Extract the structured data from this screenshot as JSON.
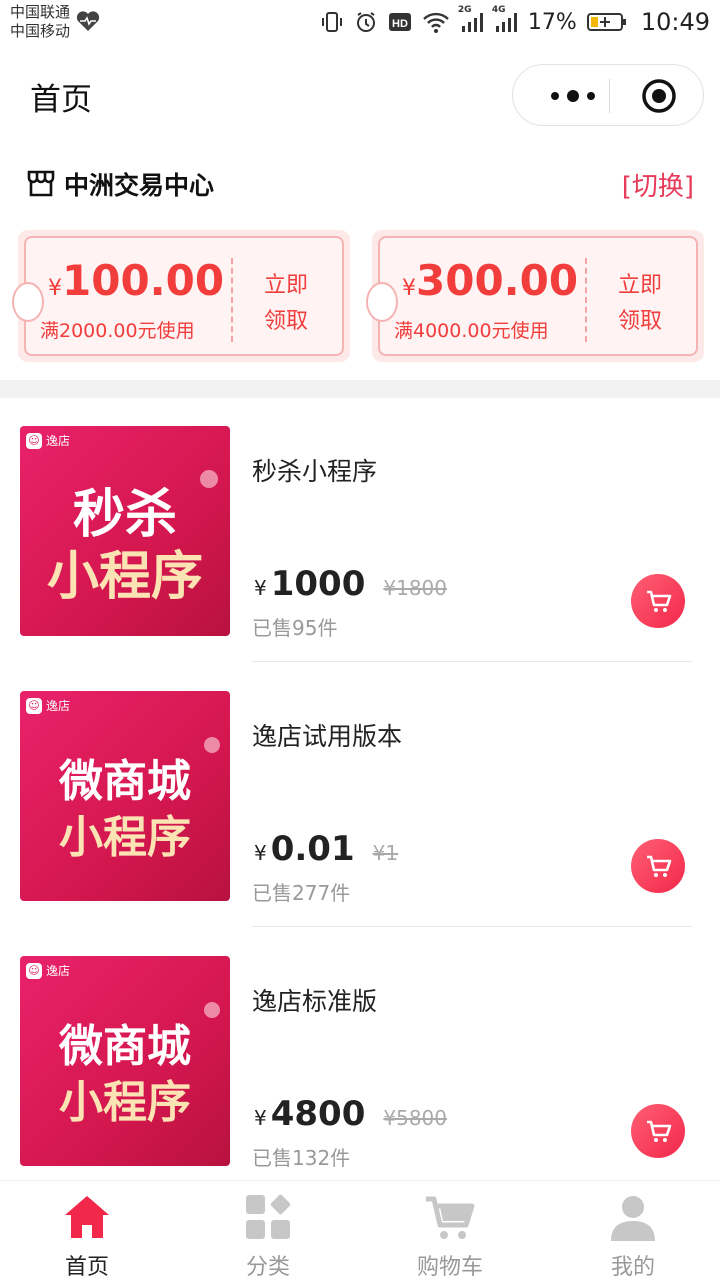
{
  "status_bar": {
    "carrier1": "中国联通",
    "carrier2": "中国移动",
    "net1": "2G",
    "net2": "4G",
    "battery": "17%",
    "time": "10:49"
  },
  "header": {
    "title": "首页"
  },
  "store": {
    "name": "中洲交易中心",
    "switch_label": "[切换]"
  },
  "coupons": [
    {
      "currency": "¥",
      "amount": "100.00",
      "condition": "满2000.00元使用",
      "claim1": "立即",
      "claim2": "领取"
    },
    {
      "currency": "¥",
      "amount": "300.00",
      "condition": "满4000.00元使用",
      "claim1": "立即",
      "claim2": "领取"
    }
  ],
  "products": [
    {
      "name": "秒杀小程序",
      "currency": "¥",
      "price": "1000",
      "original": "¥1800",
      "sold": "已售95件",
      "thumb_badge": "逸店",
      "thumb_line1": "秒杀",
      "thumb_line2": "小程序"
    },
    {
      "name": "逸店试用版本",
      "currency": "¥",
      "price": "0.01",
      "original": "¥1",
      "sold": "已售277件",
      "thumb_badge": "逸店",
      "thumb_line1": "微商城",
      "thumb_line2": "小程序"
    },
    {
      "name": "逸店标准版",
      "currency": "¥",
      "price": "4800",
      "original": "¥5800",
      "sold": "已售132件",
      "thumb_badge": "逸店",
      "thumb_line1": "微商城",
      "thumb_line2": "小程序"
    }
  ],
  "tabbar": {
    "items": [
      {
        "label": "首页",
        "icon": "home-icon"
      },
      {
        "label": "分类",
        "icon": "category-icon"
      },
      {
        "label": "购物车",
        "icon": "cart-icon"
      },
      {
        "label": "我的",
        "icon": "user-icon"
      }
    ]
  },
  "colors": {
    "accent": "#e83a5a",
    "coupon_red": "#f23d3d",
    "cart_button": "#f2284a"
  }
}
